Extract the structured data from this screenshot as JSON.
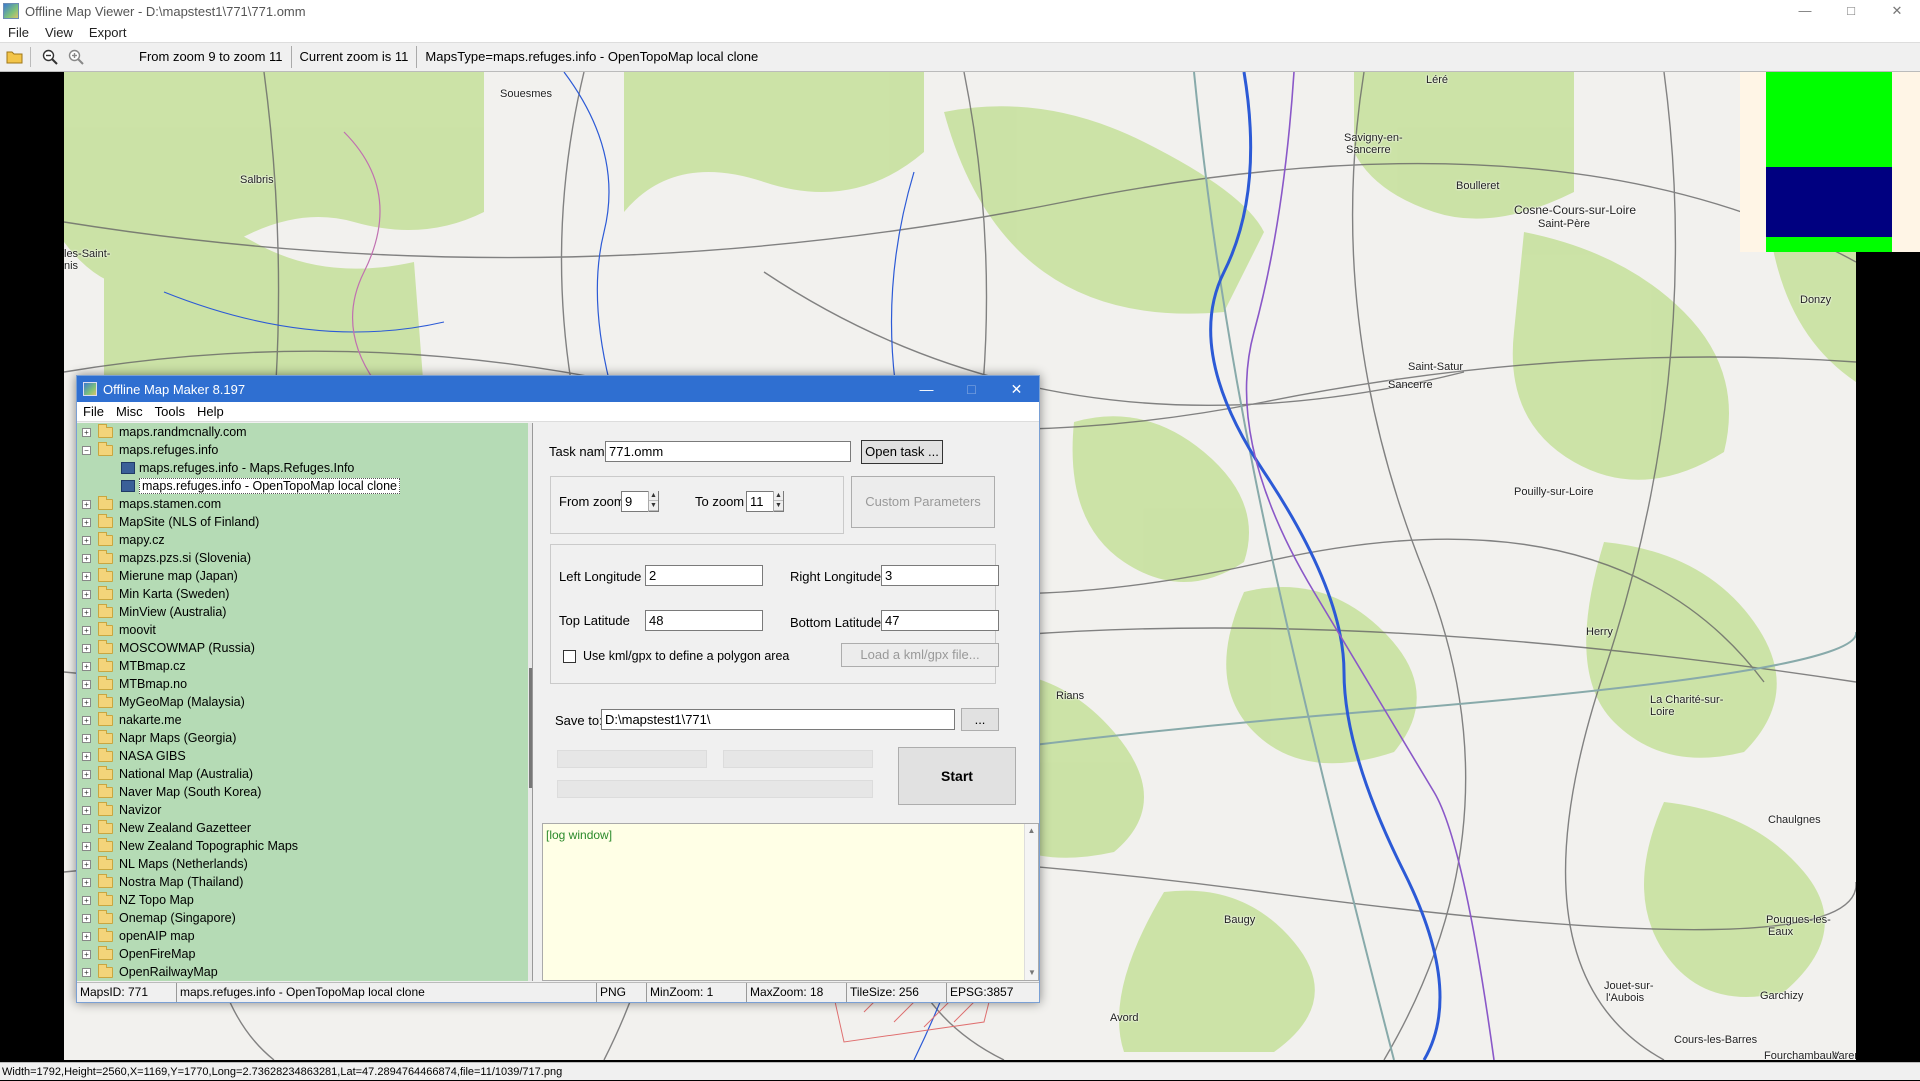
{
  "viewer": {
    "title": "Offline Map Viewer - D:\\mapstest1\\771\\771.omm",
    "menu": [
      "File",
      "View",
      "Export"
    ],
    "toolbar": {
      "zoom_range": "From zoom 9 to zoom 11",
      "current_zoom": "Current zoom is 11",
      "maps_type": "MapsType=maps.refuges.info - OpenTopoMap local clone"
    },
    "status": "Width=1792,Height=2560,X=1169,Y=1770,Long=2.73628234863281,Lat=47.2894764466874,file=11/1039/717.png",
    "window_buttons": {
      "minimize": "—",
      "maximize": "□",
      "close": "✕"
    }
  },
  "map": {
    "places": [
      "Souesmes",
      "Salbris",
      "les-Saint-",
      "nis",
      "Léré",
      "Savigny-en-",
      "Sancerre",
      "Boulleret",
      "Cosne-Cours-sur-Loire",
      "Saint-Père",
      "Donzy",
      "Saint-Satur",
      "Sancerre",
      "Pouilly-sur-Loire",
      "Herry",
      "Rians",
      "La Charité-sur-",
      "Loire",
      "Chaulgnes",
      "Baugy",
      "Pougues-les-",
      "Eaux",
      "Jouet-sur-",
      "l'Aubois",
      "Garchizy",
      "Avord",
      "Cours-les-Barres",
      "Fourchambault",
      "Varen"
    ],
    "colors": {
      "background": "#f2f1ee",
      "forest": "#c5e09a",
      "water": "#2c5ad6",
      "road": "#555555",
      "border": "#c070b0",
      "military": "#e07070"
    }
  },
  "overview": {
    "colors": {
      "land": "#00ff00",
      "sea": "#000080",
      "bg": "#fff5e6"
    }
  },
  "maker": {
    "title": "Offline Map Maker 8.197",
    "menu": [
      "File",
      "Misc",
      "Tools",
      "Help"
    ],
    "window_buttons": {
      "minimize": "—",
      "maximize": "□",
      "close": "✕"
    },
    "tree": [
      {
        "label": "maps.randmcnally.com",
        "expander": "+"
      },
      {
        "label": "maps.refuges.info",
        "expander": "−",
        "open": true
      },
      {
        "label": "maps.refuges.info - Maps.Refuges.Info",
        "child": true
      },
      {
        "label": "maps.refuges.info - OpenTopoMap local clone",
        "child": true,
        "selected": true
      },
      {
        "label": "maps.stamen.com",
        "expander": "+"
      },
      {
        "label": "MapSite (NLS of Finland)",
        "expander": "+"
      },
      {
        "label": "mapy.cz",
        "expander": "+"
      },
      {
        "label": "mapzs.pzs.si (Slovenia)",
        "expander": "+"
      },
      {
        "label": "Mierune map (Japan)",
        "expander": "+"
      },
      {
        "label": "Min Karta (Sweden)",
        "expander": "+"
      },
      {
        "label": "MinView (Australia)",
        "expander": "+"
      },
      {
        "label": "moovit",
        "expander": "+"
      },
      {
        "label": "MOSCOWMAP (Russia)",
        "expander": "+"
      },
      {
        "label": "MTBmap.cz",
        "expander": "+"
      },
      {
        "label": "MTBmap.no",
        "expander": "+"
      },
      {
        "label": "MyGeoMap (Malaysia)",
        "expander": "+"
      },
      {
        "label": "nakarte.me",
        "expander": "+"
      },
      {
        "label": "Napr Maps (Georgia)",
        "expander": "+"
      },
      {
        "label": "NASA GIBS",
        "expander": "+"
      },
      {
        "label": "National Map (Australia)",
        "expander": "+"
      },
      {
        "label": "Naver Map (South Korea)",
        "expander": "+"
      },
      {
        "label": "Navizor",
        "expander": "+"
      },
      {
        "label": "New Zealand Gazetteer",
        "expander": "+"
      },
      {
        "label": "New Zealand Topographic Maps",
        "expander": "+"
      },
      {
        "label": "NL Maps (Netherlands)",
        "expander": "+"
      },
      {
        "label": "Nostra Map (Thailand)",
        "expander": "+"
      },
      {
        "label": "NZ Topo Map",
        "expander": "+"
      },
      {
        "label": "Onemap (Singapore)",
        "expander": "+"
      },
      {
        "label": "openAIP map",
        "expander": "+"
      },
      {
        "label": "OpenFireMap",
        "expander": "+"
      },
      {
        "label": "OpenRailwayMap",
        "expander": "+"
      }
    ],
    "form": {
      "task_name_label": "Task name",
      "task_name_value": "771.omm",
      "open_task_button": "Open task ...",
      "from_zoom_label": "From zoom",
      "from_zoom_value": "9",
      "to_zoom_label": "To zoom",
      "to_zoom_value": "11",
      "custom_params_button": "Custom Parameters",
      "left_lon_label": "Left Longitude",
      "left_lon_value": "2",
      "right_lon_label": "Right Longitude",
      "right_lon_value": "3",
      "top_lat_label": "Top Latitude",
      "top_lat_value": "48",
      "bottom_lat_label": "Bottom Latitude",
      "bottom_lat_value": "47",
      "use_kml_label": "Use kml/gpx to define a polygon area",
      "use_kml_checked": false,
      "load_kml_button": "Load a kml/gpx file...",
      "save_to_label": "Save to:",
      "save_to_value": "D:\\mapstest1\\771\\",
      "browse_button": "...",
      "start_button": "Start"
    },
    "log_text": "[log window]",
    "status": {
      "maps_id": "MapsID: 771",
      "maps_name": "maps.refuges.info - OpenTopoMap local clone",
      "format": "PNG",
      "min_zoom": "MinZoom: 1",
      "max_zoom": "MaxZoom: 18",
      "tile_size": "TileSize: 256",
      "epsg": "EPSG:3857"
    }
  }
}
